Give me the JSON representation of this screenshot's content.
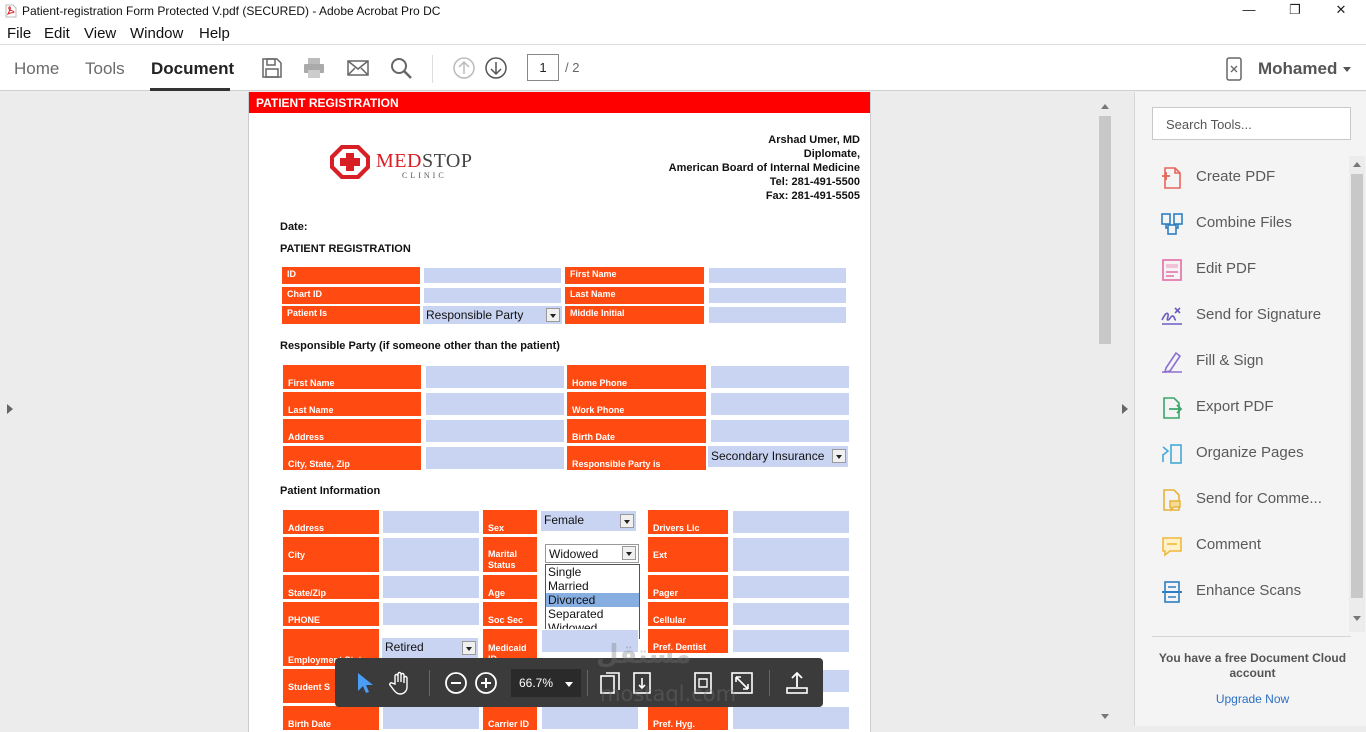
{
  "window": {
    "title": "Patient-registration Form Protected V.pdf (SECURED) - Adobe Acrobat Pro DC",
    "minimize": "—",
    "maximize": "❐",
    "close": "✕"
  },
  "menu": [
    "File",
    "Edit",
    "View",
    "Window",
    "Help"
  ],
  "toolbar": {
    "tabs": [
      "Home",
      "Tools",
      "Document"
    ],
    "active_tab": "Document",
    "page_current": "1",
    "page_total": "/ 2",
    "user": "Mohamed"
  },
  "document": {
    "banner": "PATIENT REGISTRATION",
    "logo": {
      "med": "MED",
      "stop": "STOP",
      "clinic": "CLINIC"
    },
    "doctor": [
      "Arshad Umer, MD",
      "Diplomate,",
      "American Board of Internal Medicine",
      "Tel: 281-491-5500",
      "Fax: 281-491-5505"
    ],
    "date_label": "Date:",
    "section_title": "PATIENT REGISTRATION",
    "id_section": {
      "id": "ID",
      "chart_id": "Chart ID",
      "patient_is": "Patient Is",
      "patient_is_value": "Responsible Party",
      "first_name": "First Name",
      "last_name": "Last Name",
      "middle_initial": "Middle Initial"
    },
    "responsible_title": "Responsible Party (if someone other than the patient)",
    "responsible": {
      "first_name": "First Name",
      "last_name": "Last Name",
      "address": "Address",
      "city": "City, State, Zip",
      "home_phone": "Home Phone",
      "work_phone": "Work Phone",
      "birth_date": "Birth Date",
      "party_is": "Responsible Party is",
      "party_is_value": "Secondary Insurance"
    },
    "patient_info_title": "Patient Information",
    "patient": {
      "address": "Address",
      "city": "City",
      "state_zip": "State/Zip",
      "phone": "PHONE",
      "employment": "Employment Status",
      "employment_value": "Retired",
      "student": "Student S",
      "birth_date": "Birth Date",
      "sex": "Sex",
      "sex_value": "Female",
      "marital": "Marital Status",
      "marital_value": "Widowed",
      "marital_options": [
        "Single",
        "Married",
        "Divorced",
        "Separated",
        "Widowed"
      ],
      "marital_highlight": "Divorced",
      "age": "Age",
      "soc_sec": "Soc Sec",
      "medicaid": "Medicaid ID",
      "carrier": "Carrier ID",
      "drivers": "Drivers Lic",
      "ext": "Ext",
      "pager": "Pager",
      "cellular": "Cellular",
      "pref_dentist": "Pref. Dentist",
      "pref_hyg": "Pref. Hyg."
    }
  },
  "tools": {
    "search_placeholder": "Search Tools...",
    "items": [
      {
        "label": "Create PDF",
        "icon": "create-pdf-icon",
        "color": "#e8655a"
      },
      {
        "label": "Combine Files",
        "icon": "combine-files-icon",
        "color": "#2d7fc1"
      },
      {
        "label": "Edit PDF",
        "icon": "edit-pdf-icon",
        "color": "#e36ca8"
      },
      {
        "label": "Send for Signature",
        "icon": "send-signature-icon",
        "color": "#6a5fc1"
      },
      {
        "label": "Fill & Sign",
        "icon": "fill-sign-icon",
        "color": "#8e6fd1"
      },
      {
        "label": "Export PDF",
        "icon": "export-pdf-icon",
        "color": "#3aa66a"
      },
      {
        "label": "Organize Pages",
        "icon": "organize-pages-icon",
        "color": "#46a9d6"
      },
      {
        "label": "Send for Comme...",
        "icon": "send-comments-icon",
        "color": "#e7b23a"
      },
      {
        "label": "Comment",
        "icon": "comment-icon",
        "color": "#f0b93a"
      },
      {
        "label": "Enhance Scans",
        "icon": "enhance-scans-icon",
        "color": "#2d7fc1"
      }
    ],
    "cloud_message": "You have a free Document Cloud account",
    "upgrade": "Upgrade Now"
  },
  "floatbar": {
    "zoom": "66.7%"
  },
  "watermark": {
    "arabic": "مستقل",
    "latin": "mostaql.com"
  }
}
